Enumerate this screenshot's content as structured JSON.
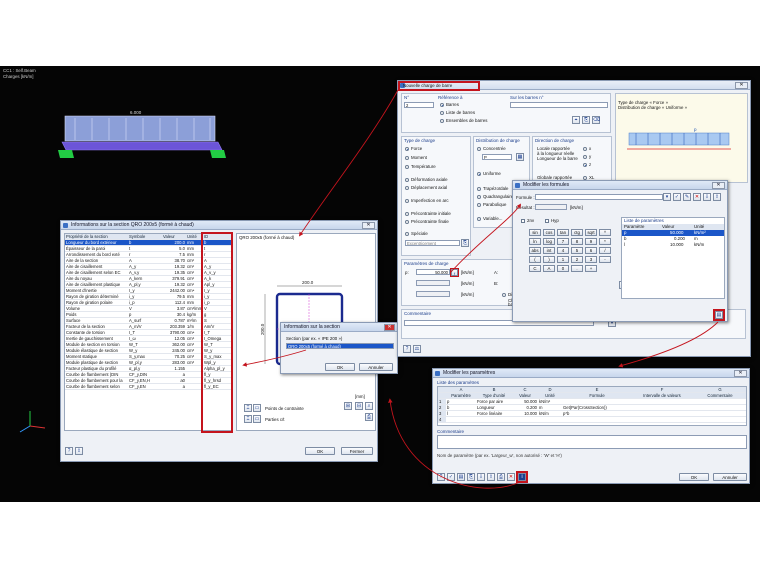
{
  "viewport": {
    "status_line1": "CC1 : Self.Beam",
    "status_line2": "Charges [kN/m]",
    "beam_load_label": "6.000"
  },
  "colors": {
    "accent_red": "#c4141d",
    "load_fill": "#8c9fd8",
    "beam_color": "#6c55d8",
    "support_green": "#22cc44",
    "desktop": "#050505"
  },
  "info_window": {
    "title": "Informations sur la section QRO 200x5 (formé à chaud)",
    "preview_title": "QRO 200x5 (formé à chaud)",
    "dim_top": "200.0",
    "dim_left": "200.0",
    "unit_label": "[mm]",
    "columns": [
      "Propriété de la section",
      "Symbole",
      "Valeur",
      "Unité",
      "ID"
    ],
    "rows": [
      [
        "Longueur du bord extérieur",
        "b",
        "200.0",
        "mm",
        "b"
      ],
      [
        "Épaisseur de la paroi",
        "t",
        "5.0",
        "mm",
        "t"
      ],
      [
        "Arrondissement du bord exté",
        "r",
        "7.5",
        "mm",
        "r"
      ],
      [
        "Aire de la section",
        "A",
        "38.70",
        "cm²",
        "A"
      ],
      [
        "Aire de cisaillement",
        "A_y",
        "19.32",
        "cm²",
        "A_y"
      ],
      [
        "Aire de cisaillement selon EC",
        "A_v,y",
        "19.35",
        "cm²",
        "A_v_y"
      ],
      [
        "Aire du noyau",
        "A_kern",
        "379.91",
        "cm²",
        "A_k"
      ],
      [
        "Aire de cisaillement plastique",
        "A_pl,y",
        "19.32",
        "cm²",
        "Apl_y"
      ],
      [
        "Moment d'inertie",
        "I_y",
        "2442.00",
        "cm⁴",
        "I_y"
      ],
      [
        "Rayon de giration déterminé",
        "i_y",
        "79.5",
        "mm",
        "i_y"
      ],
      [
        "Rayon de giration polaire",
        "i_p",
        "112.4",
        "mm",
        "i_p"
      ],
      [
        "Volume",
        "V",
        "3.87",
        "cm³/mm",
        "V"
      ],
      [
        "Poids",
        "p",
        "30.4",
        "kg/m",
        "g"
      ],
      [
        "Surface",
        "A_surf",
        "0.787",
        "m²/m",
        "S"
      ],
      [
        "Facteur de la section",
        "A_m/V",
        "203.359",
        "1/m",
        "Am/V"
      ],
      [
        "Constante de torsion",
        "I_T",
        "3790.00",
        "cm⁴",
        "I_T"
      ],
      [
        "Inertie de gauchissement",
        "I_ω",
        "12.05",
        "cm⁶",
        "I_Omega"
      ],
      [
        "Module de section en torsion",
        "W_T",
        "362.00",
        "cm³",
        "W_T"
      ],
      [
        "Module élastique de section",
        "W_y",
        "245.00",
        "cm³",
        "W_y"
      ],
      [
        "Moment statique",
        "S_y,max",
        "70.25",
        "cm³",
        "S_y_max"
      ],
      [
        "Module plastique de section",
        "W_pl,y",
        "283.00",
        "cm³",
        "Wpl_y"
      ],
      [
        "Facteur plastique du profilé",
        "α_pl,y",
        "1.155",
        "",
        "Alpha_pl_y"
      ],
      [
        "Courbe de flambement (DIN",
        "CF_y,DIN",
        "a",
        "",
        "fl_y"
      ],
      [
        "Courbe de flambement pour la",
        "CF_y,EN,H",
        "a0",
        "",
        "fl_y_hrsd"
      ],
      [
        "Courbe de flambement selon",
        "CF_y,EN",
        "a",
        "",
        "fl_y_EC"
      ]
    ],
    "opt1": "Points de contrainte",
    "opt2": "Parties c/t",
    "ok": "OK",
    "close": "Fermer"
  },
  "load_dialog": {
    "title": "Nouvelle charge de barre",
    "no_label": "N°",
    "no_value": "2",
    "ref_label": "Référence à",
    "on_bars_label": "Sur les barres n°",
    "ref_opts": [
      "Barres",
      "Liste de barres",
      "Ensembles de barres"
    ],
    "load_type_title": "Type de charge",
    "load_types": [
      "Force",
      "Moment",
      "Température",
      "Déformation axiale",
      "Déplacement axial",
      "Imperfection en arc",
      "Précontrainte initiale",
      "Précontrainte finale"
    ],
    "dist_title": "Distribution de charge",
    "dist_opts": [
      "Concentrée",
      "Uniforme",
      "Trapézoïdale",
      "Quadrangulaire",
      "Parabolique",
      "Variable..."
    ],
    "dist_p": "P",
    "dist_n": "n",
    "dir_title": "Direction de charge",
    "dir_text1": "Locale rapportée",
    "dir_text2": "à la longueur réelle",
    "dir_text3": "Longueur de la barre",
    "dir_x": "x",
    "dir_y": "y",
    "dir_z": "z",
    "dir_global": "Globale rapportée",
    "dir_xl": "XL",
    "special_label": "Spéciale",
    "special_value": "Excentricement",
    "params_title": "Paramètres de charge",
    "p_label": "p:",
    "p_value": "50.000",
    "p_unit": "[kN/m]",
    "p1_unit": "[kN/m]",
    "p2_unit": "[kN/m]",
    "a_label": "A:",
    "b_label": "B:",
    "dist_label": "Distance",
    "ref_len_label": "Charge sur la longueur totale de",
    "ref_len_label2": "barre",
    "preview_text1": "Type de charge « Force »",
    "preview_text2": "Distribution de charge « Uniforme »",
    "preview_p": "p",
    "comment_label": "Commentaire"
  },
  "formula_dialog": {
    "title": "Modifier les formules",
    "formula_label": "Formule :",
    "result_label": "Résultat :",
    "result_unit": "[kN/m]",
    "chk1": "2nv",
    "chk2": "Hyp",
    "keys": [
      [
        "sin",
        "cos",
        "tan",
        "ctg",
        "sqrt",
        "^"
      ],
      [
        "ln",
        "log",
        "7",
        "8",
        "9",
        "*"
      ],
      [
        "abs",
        "int",
        "4",
        "5",
        "6",
        "/"
      ],
      [
        "(",
        ")",
        "1",
        "2",
        "3",
        "-"
      ],
      [
        "C",
        "A",
        "0",
        ".",
        "+",
        ""
      ]
    ],
    "params_title": "Liste de paramètres",
    "params_cols": [
      "Paramètre",
      "Valeur",
      "Unité"
    ],
    "params_rows": [
      [
        "p",
        "50.000",
        "kN/m²"
      ],
      [
        "b",
        "0.200",
        "m"
      ],
      [
        "l",
        "10.000",
        "kN/m"
      ]
    ]
  },
  "edit_params": {
    "title": "Modifier les paramètres",
    "list_title": "Liste des paramètres",
    "col_letters": [
      "A",
      "B",
      "C",
      "D",
      "E",
      "F",
      "G"
    ],
    "cols": [
      "Paramètre",
      "Type d'unité",
      "Valeur",
      "Unité",
      "Formule",
      "Intervalle de valeurs",
      "Commentaire"
    ],
    "rows": [
      [
        "1",
        "p",
        "Force par aire",
        "50.000",
        "kN/m²",
        "",
        ""
      ],
      [
        "2",
        "b",
        "Longueur",
        "0.200",
        "m",
        "Get(Par(CrossSection))",
        ""
      ],
      [
        "3",
        "l",
        "Force linéaire",
        "10.000",
        "kN/m",
        "p*b",
        ""
      ],
      [
        "4",
        "",
        "",
        "",
        "",
        "",
        ""
      ]
    ],
    "comment_label": "Commentaire",
    "hint": "Nom de paramètre (par ex. 'Largeur_w', non autorisé : 'W' et 'H')",
    "ok": "OK",
    "cancel": "Annuler"
  },
  "section_info": {
    "title": "Information sur la section",
    "text": "Section (par ex. « IPE 200 »)",
    "value": "QRO 200x5 (formé à chaud)",
    "ok": "OK",
    "cancel": "Annuler"
  }
}
